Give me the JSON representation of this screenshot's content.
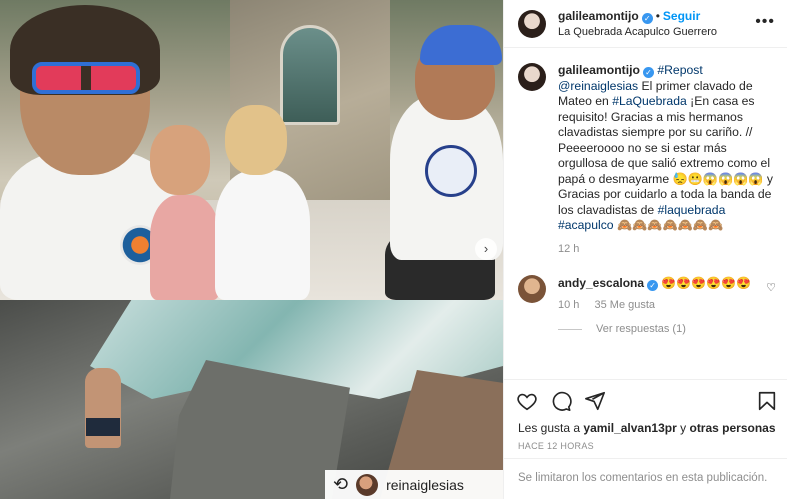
{
  "post": {
    "author": "galileamontijo",
    "follow_label": "Seguir",
    "location": "La Quebrada Acapulco Guerrero",
    "more_label": "•••",
    "verified_glyph": "✓"
  },
  "media": {
    "repost_username": "reinaiglesias",
    "carousel_next": "›"
  },
  "caption": {
    "author": "galileamontijo",
    "repost_tag": "#Repost",
    "mention": "@reinaiglesias",
    "text1": "El primer clavado de Mateo en",
    "hashtag1": "#LaQuebrada",
    "text2": "¡En casa es requisito! Gracias a mis hermanos clavadistas siempre por su cariño. // Peeeeroooo no se si estar más orgullosa de que salió extremo como el papá o desmayarme 😓😬😱😱😱😱 y Gracias por cuidarlo a toda la banda de los clavadistas de",
    "hashtag2": "#laquebrada",
    "hashtag3": "#acapulco",
    "emojis_end": "🙈🙈🙈🙈🙈🙈🙈",
    "time": "12 h"
  },
  "comment": {
    "author": "andy_escalona",
    "text": "😍😍😍😍😍😍",
    "time": "10 h",
    "likes": "35 Me gusta",
    "replies": "Ver respuestas (1)"
  },
  "actions": {
    "like_icon": "heart-icon",
    "comment_icon": "comment-icon",
    "share_icon": "share-icon",
    "save_icon": "bookmark-icon"
  },
  "likes": {
    "prefix": "Les gusta a",
    "user": "yamil_alvan13pr",
    "middle": "y",
    "others": "otras personas"
  },
  "timestamp": "HACE 12 HORAS",
  "comments_limited": "Se limitaron los comentarios en esta publicación."
}
